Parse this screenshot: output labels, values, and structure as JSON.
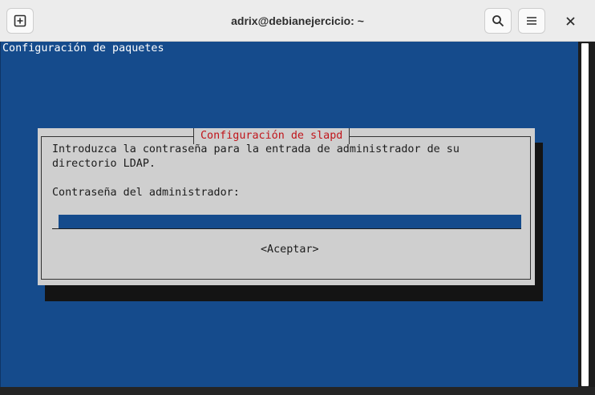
{
  "window": {
    "title": "adrix@debianejercicio: ~",
    "icons": {
      "new_tab": "new-tab-icon",
      "search": "search-icon",
      "menu": "hamburger-menu-icon",
      "close": "close-icon"
    }
  },
  "terminal": {
    "heading": "Configuración de paquetes",
    "colors": {
      "background": "#154b8c",
      "dialog": "#cfcfcf",
      "title_accent": "#c0151b"
    }
  },
  "dialog": {
    "title": "Configuración de slapd",
    "line1": "Introduzca la contraseña para la entrada de administrador de su",
    "line2": "directorio LDAP.",
    "label": "Contraseña del administrador:",
    "password_value": "",
    "accept_label": "<Aceptar>"
  }
}
